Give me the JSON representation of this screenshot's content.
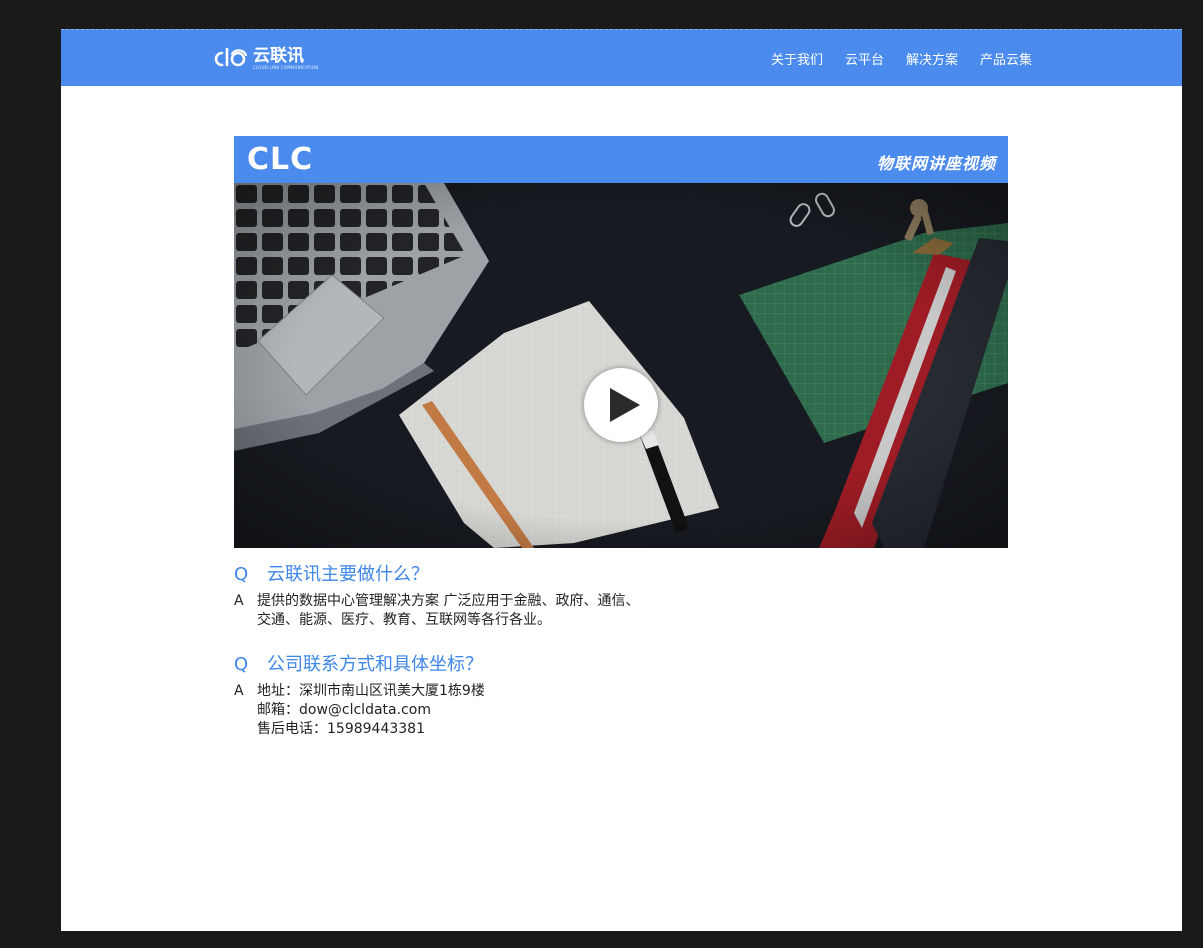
{
  "header": {
    "logo_name": "云联讯",
    "logo_sub": "CLOUD LINK COMMUNICATION",
    "nav": [
      "关于我们",
      "云平台",
      "解决方案",
      "产品云集"
    ]
  },
  "video": {
    "brand": "CLC",
    "caption": "物联网讲座视频"
  },
  "faq": [
    {
      "q_mark": "Q",
      "question": "云联讯主要做什么？",
      "a_mark": "A",
      "answer_lines": [
        "提供的数据中心管理解决方案 广泛应用于金融、政府、通信、",
        "交通、能源、医疗、教育、互联网等各行各业。"
      ]
    },
    {
      "q_mark": "Q",
      "question": "公司联系方式和具体坐标？",
      "a_mark": "A",
      "answer_lines": [
        "地址：深圳市南山区讯美大厦1栋9楼",
        "邮箱：dow@clcldata.com",
        "售后电话：15989443381"
      ]
    }
  ],
  "colors": {
    "primary": "#4b8bee",
    "question": "#3e86e8",
    "backdrop": "#1a1a1a"
  }
}
